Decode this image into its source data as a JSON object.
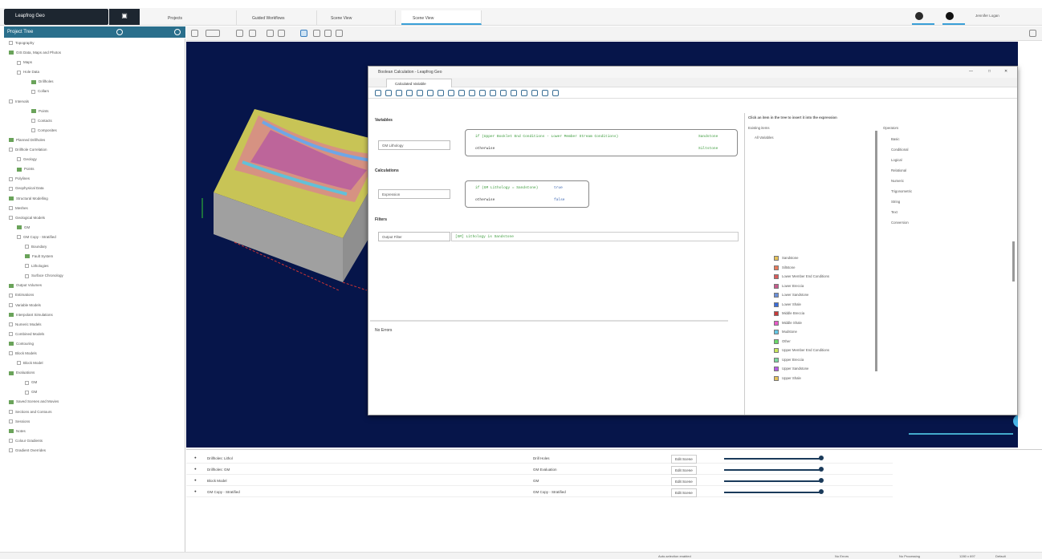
{
  "app": {
    "brand": "Leapfrog Geo",
    "user": "Jennifer Logan"
  },
  "tabs": [
    {
      "label": "Projects"
    },
    {
      "label": "Guided Workflows"
    },
    {
      "label": "Scene View"
    },
    {
      "label": "Scene View"
    }
  ],
  "project_tree": {
    "header": "Project Tree",
    "items": [
      "Topography",
      "GIS Data, Maps and Photos",
      "Maps",
      "Hole Data",
      "Drillholes",
      "Collars",
      "Intervals",
      "Points",
      "Contacts",
      "Composites",
      "Planned Drillholes",
      "Drillhole Correlation",
      "Geology",
      "Points",
      "Polylines",
      "Geophysical Data",
      "Structural Modelling",
      "Meshes",
      "Geological Models",
      "GM",
      "GM Copy - Stratified",
      "Boundary",
      "Fault System",
      "Lithologies",
      "Surface Chronology",
      "Output Volumes",
      "Estimations",
      "Variable Models",
      "Interpolant Simulations",
      "Numeric Models",
      "Combined Models",
      "Contouring",
      "Block Models",
      "Block Model",
      "Evaluations",
      "GM",
      "GM",
      "Saved Scenes and Movies",
      "Sections and Contours",
      "Sessions",
      "Notes",
      "Colour Gradients",
      "Gradient Overrides"
    ]
  },
  "dialog": {
    "title": "Boolean Calculation - Leapfrog Geo",
    "tab": "Calculated Variable",
    "sections": {
      "variables_label": "Variables",
      "variables_dropdown": "GM Lithology",
      "variables_expr_1": "if (Upper Booklet End Conditions - Lower Member Stream Conditions)",
      "variables_expr_1_result": "Sandstone",
      "variables_expr_2": "otherwise",
      "variables_expr_2_result": "Siltstone",
      "categories_label": "Calculations",
      "categories_dropdown": "Expression",
      "categories_expr_1": "if (GM Lithology = Sandstone)",
      "categories_expr_1_result": "true",
      "categories_expr_2": "otherwise",
      "categories_expr_2_result": "false",
      "filters_label": "Filters",
      "filters_dropdown": "Output Filter",
      "filters_expr": "[GM] Lithology is Sandstone",
      "errors_label": "No Errors"
    },
    "right_panel": {
      "header": "Click an item in the tree to insert it into the expression",
      "existing_items_label": "Existing items",
      "functions_label": "Operators",
      "all_variables_label": "All Variables",
      "colors_hex": [
        "#e6c35a",
        "#e97a5a",
        "#d95a5a",
        "#c85a8c",
        "#6a8fd9",
        "#3a6cd9",
        "#c83a3a",
        "#e85ac8",
        "#64c8e6",
        "#6ad96a",
        "#c8e65a",
        "#7ad9a0",
        "#b45ae6"
      ],
      "lithologies": [
        "Sandstone",
        "Siltstone",
        "Lower Member End Conditions",
        "Lower Breccia",
        "Lower Sandstone",
        "Lower Shale",
        "Middle Breccia",
        "Middle Shale",
        "Mudstone",
        "Other",
        "Upper Member End Conditions",
        "Upper Breccia",
        "Upper Sandstone",
        "Upper Shale"
      ],
      "functions": [
        "Basic",
        "Conditional",
        "Logical",
        "Relational",
        "Numeric",
        "Trigonometric",
        "String",
        "Text",
        "Conversion"
      ]
    }
  },
  "scene_list": {
    "rows": [
      {
        "name": "Drillholes: Lithol",
        "col2": "Drill Holes",
        "btn": "Edit Scene"
      },
      {
        "name": "Drillholes: GM",
        "col2": "GM Evaluation",
        "btn": "Edit Scene"
      },
      {
        "name": "Block Model",
        "col2": "GM",
        "btn": "Edit Scene"
      },
      {
        "name": "GM Copy - Stratified",
        "col2": "GM Copy - Stratified",
        "btn": "Edit Scene"
      }
    ]
  },
  "status_bar": {
    "items": [
      "Auto-selection enabled",
      "No Errors",
      "No Processing",
      "1280 x 697",
      "Default"
    ]
  }
}
